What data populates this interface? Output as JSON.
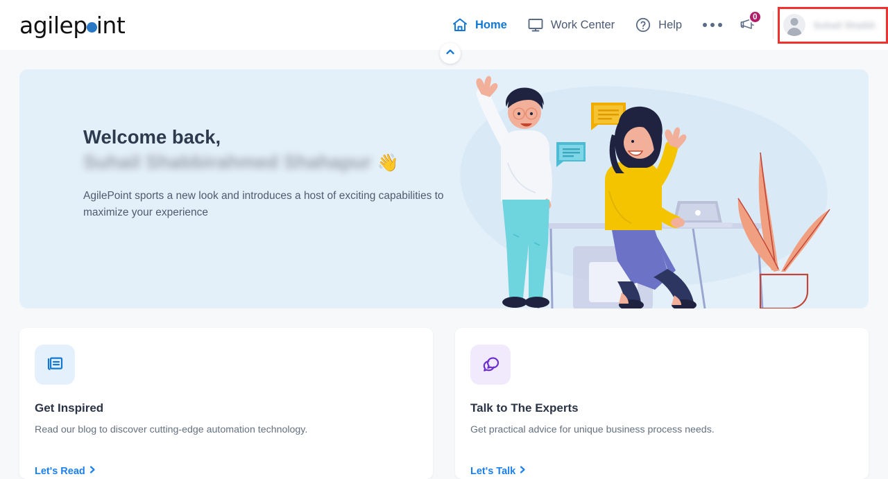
{
  "brand": {
    "name_part1": "agilep",
    "name_part2": "int",
    "dot_color": "#2878c4"
  },
  "header": {
    "nav": [
      {
        "label": "Home",
        "icon": "home-icon",
        "active": true
      },
      {
        "label": "Work Center",
        "icon": "monitor-icon",
        "active": false
      },
      {
        "label": "Help",
        "icon": "question-circle-icon",
        "active": false
      }
    ],
    "more_label": "More options",
    "notifications": {
      "icon": "megaphone-icon",
      "count": "0",
      "badge_color": "#b01d69"
    },
    "user": {
      "name": "Suhail Shaikh",
      "avatar_icon": "user-avatar-icon",
      "redacted": true
    },
    "collapse_icon": "chevron-up-icon",
    "highlight_color": "#f0322e"
  },
  "banner": {
    "greeting": "Welcome back,",
    "user_name": "Suhail Shabbirahmed Shahapur",
    "wave_emoji": "👋",
    "subtitle": "AgilePoint sports a new look and introduces a host of exciting capabilities to maximize your experience",
    "background_color": "#e4f0f9"
  },
  "cards": [
    {
      "icon": "newspaper-icon",
      "icon_color": "#1377d4",
      "icon_bg": "#e4f0fb",
      "title": "Get Inspired",
      "description": "Read our blog to discover cutting-edge automation technology.",
      "link_label": "Let's Read",
      "link_icon": "chevron-right-icon"
    },
    {
      "icon": "chat-bubbles-icon",
      "icon_color": "#6d2fd0",
      "icon_bg": "#f0eafc",
      "title": "Talk to The Experts",
      "description": "Get practical advice for unique business process needs.",
      "link_label": "Let's Talk",
      "link_icon": "chevron-right-icon"
    }
  ]
}
